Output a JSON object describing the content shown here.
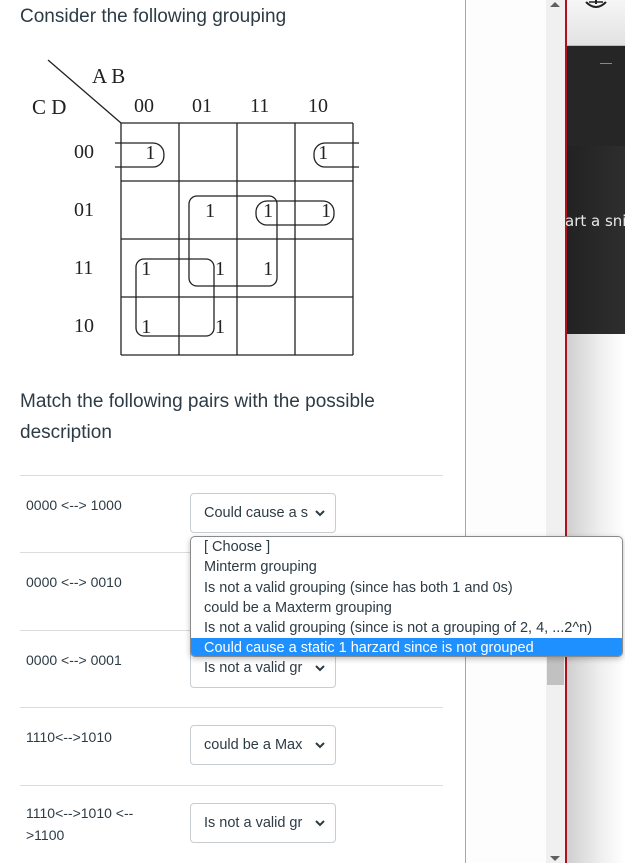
{
  "question": {
    "title": "Consider the following grouping",
    "prompt": "Match the following pairs with the possible description"
  },
  "kmap": {
    "row_var": "C D",
    "col_var": "A B",
    "col_labels": [
      "00",
      "01",
      "11",
      "10"
    ],
    "row_labels": [
      "00",
      "01",
      "11",
      "10"
    ],
    "cells": [
      [
        "1",
        "",
        "",
        "1"
      ],
      [
        "",
        "1",
        "1",
        "1"
      ],
      [
        "1",
        "1",
        "1",
        ""
      ],
      [
        "1",
        "1",
        "",
        ""
      ]
    ]
  },
  "pairs": [
    {
      "label": "0000 <--> 1000",
      "selected": "Could cause a static 1 harzard since is not grouped",
      "display": "Could cause a s"
    },
    {
      "label": "0000 <--> 0010",
      "selected": "",
      "display": ""
    },
    {
      "label": "0000 <--> 0001",
      "selected": "Is not a valid grouping (since has both 1 and 0s)",
      "display": "Is not a valid gr"
    },
    {
      "label": "1110<-->1010",
      "selected": "could be a Maxterm grouping",
      "display": "could be a Max"
    },
    {
      "label": "1110<-->1010 <-->1100",
      "selected": "Is not a valid grouping (since is not a grouping of 2, 4, ...2^n)",
      "display": "Is not a valid gr"
    }
  ],
  "dropdown": {
    "options": [
      "[ Choose ]",
      "Minterm grouping",
      "Is not a valid grouping (since has both 1 and 0s)",
      "could be a Maxterm grouping",
      "Is not a valid grouping (since is not a grouping of 2, 4, ...2^n)",
      "Could cause a static 1 harzard since is not grouped"
    ],
    "highlighted_index": 5
  },
  "side_panel": {
    "snip_text": "art a sni"
  },
  "colors": {
    "highlight": "#1e90ff",
    "text": "#2d3b45",
    "accent_line": "#b01020"
  }
}
